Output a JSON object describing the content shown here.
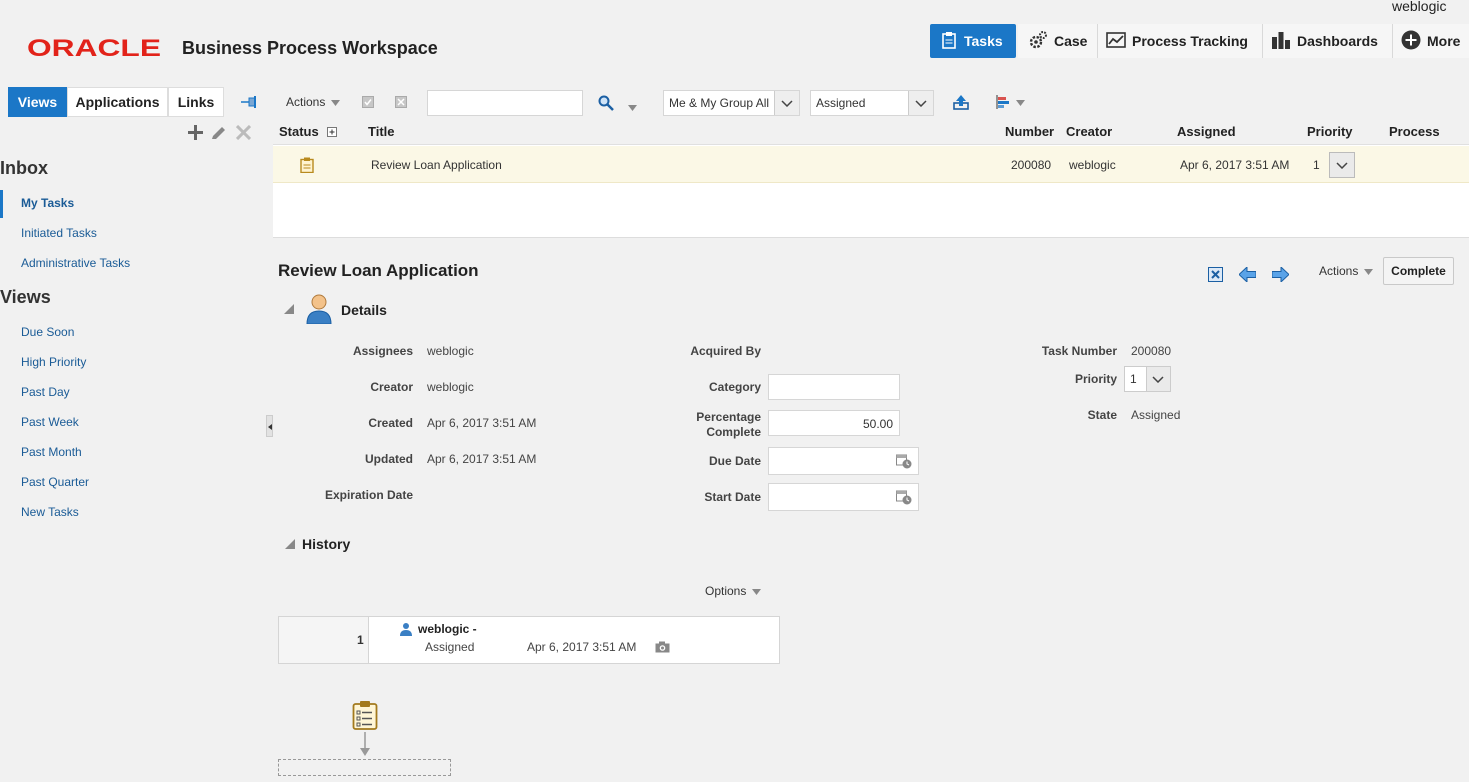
{
  "user": "weblogic",
  "brand": {
    "logo": "ORACLE",
    "title": "Business Process Workspace"
  },
  "topnav": {
    "tasks": "Tasks",
    "case": "Case",
    "process_tracking": "Process Tracking",
    "dashboards": "Dashboards",
    "more": "More"
  },
  "left_tabs": {
    "views": "Views",
    "applications": "Applications",
    "links": "Links"
  },
  "sidebar": {
    "inbox_heading": "Inbox",
    "inbox_items": [
      "My Tasks",
      "Initiated Tasks",
      "Administrative Tasks"
    ],
    "views_heading": "Views",
    "views_items": [
      "Due Soon",
      "High Priority",
      "Past Day",
      "Past Week",
      "Past Month",
      "Past Quarter",
      "New Tasks"
    ]
  },
  "toolbar": {
    "actions": "Actions",
    "search_value": "",
    "scope": "Me & My Group All",
    "state_filter": "Assigned"
  },
  "table": {
    "headers": {
      "status": "Status",
      "title": "Title",
      "number": "Number",
      "creator": "Creator",
      "assigned": "Assigned",
      "priority": "Priority",
      "process": "Process"
    },
    "row": {
      "title": "Review Loan Application",
      "number": "200080",
      "creator": "weblogic",
      "assigned": "Apr 6, 2017 3:51 AM",
      "priority": "1"
    }
  },
  "detail": {
    "title": "Review Loan Application",
    "actions": "Actions",
    "complete": "Complete",
    "details_heading": "Details",
    "labels": {
      "assignees": "Assignees",
      "creator": "Creator",
      "created": "Created",
      "updated": "Updated",
      "expiration": "Expiration Date",
      "acquired_by": "Acquired By",
      "category": "Category",
      "percentage_1": "Percentage",
      "percentage_2": "Complete",
      "due_date": "Due Date",
      "start_date": "Start Date",
      "task_number": "Task Number",
      "priority": "Priority",
      "state": "State"
    },
    "values": {
      "assignees": "weblogic",
      "creator": "weblogic",
      "created": "Apr 6, 2017 3:51 AM",
      "updated": "Apr 6, 2017 3:51 AM",
      "category": "",
      "percentage": "50.00",
      "task_number": "200080",
      "priority": "1",
      "state": "Assigned"
    },
    "history_heading": "History",
    "options": "Options",
    "history": {
      "index": "1",
      "user": "weblogic -",
      "action": "Assigned",
      "date": "Apr 6, 2017 3:51 AM"
    }
  },
  "colors": {
    "oracle_red": "#e2231a",
    "accent_blue": "#1b77c7",
    "link_blue": "#1a5b96",
    "row_highlight": "#fbf8e6"
  }
}
